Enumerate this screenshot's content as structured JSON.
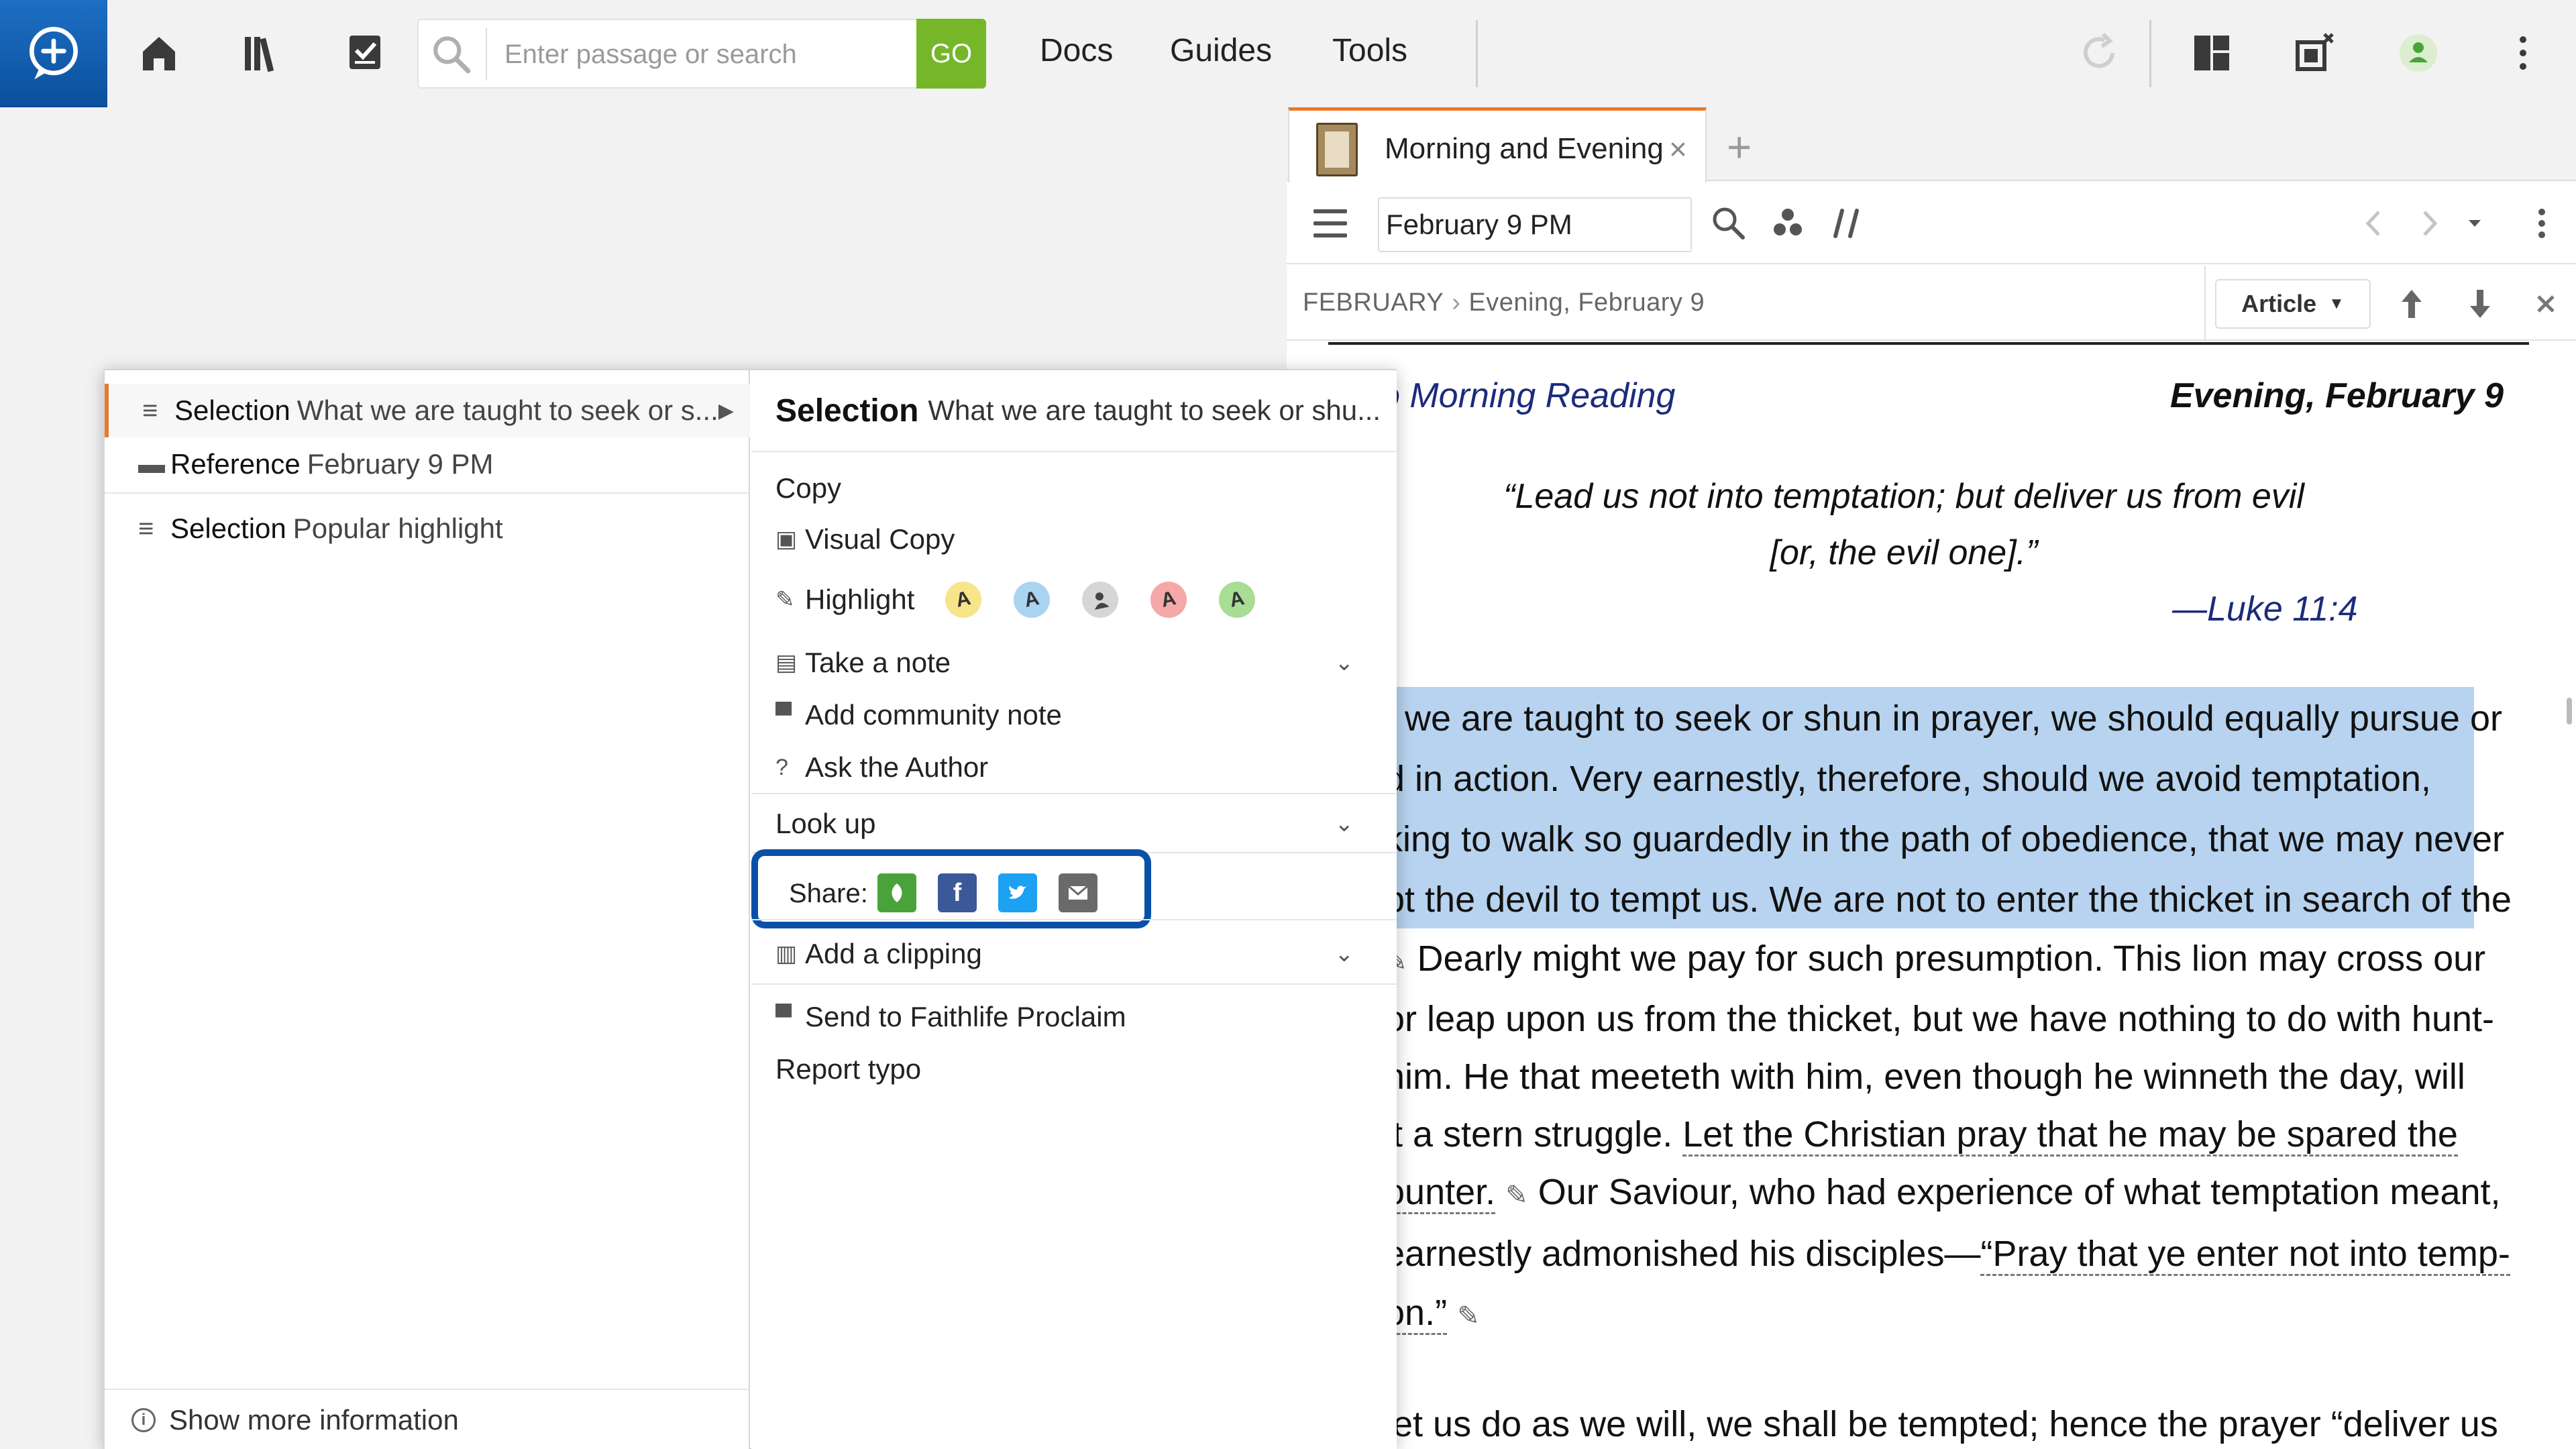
{
  "topbar": {
    "search_placeholder": "Enter passage or search",
    "go_label": "GO",
    "nav": [
      "Docs",
      "Guides",
      "Tools"
    ],
    "icons": [
      "logos-logo-icon",
      "home-icon",
      "library-icon",
      "checklist-icon",
      "search-icon",
      "sync-icon",
      "layout-icon",
      "close-panels-icon",
      "user-icon",
      "more-icon"
    ]
  },
  "panel": {
    "tab_title": "Morning and Evening",
    "tab_close": "×",
    "tab_add": "+",
    "reference_value": "February 9 PM",
    "breadcrumb": {
      "part1": "FEBRUARY",
      "separator": "›",
      "part2": "Evening, February 9"
    },
    "view_label": "Article"
  },
  "article": {
    "left_link": "o Morning Reading",
    "right_date": "Evening, February 9",
    "quote_line1": "“Lead us not into temptation; but deliver us from evil",
    "quote_line2": "[or, the evil one].”",
    "quote_ref": "—Luke 11:4",
    "lines": [
      "t we are taught to seek or shun in prayer, we should equally pursue or",
      "d in action. Very earnestly, therefore, should we avoid temptation,",
      "king to walk so guardedly in the path of obedience, that we may never",
      "pt the devil to tempt us. We are not to enter the thicket in search of the",
      "Dearly might we pay for such presumption. This lion may cross our",
      "or leap upon us from the thicket, but we have nothing to do with hunt-",
      "him. He that meeteth with him, even though he winneth the day, will",
      "it a stern struggle.",
      "Let the Christian pray that he may be spared the",
      "ounter.",
      "Our Saviour, who had experience of what temptation meant,",
      "earnestly admonished his disciples—",
      "“Pray that ye enter not into temp-",
      "on.”",
      "let us do as we will, we shall be tempted; hence the prayer “deliver us"
    ]
  },
  "context_menu": {
    "left": {
      "items": [
        {
          "key": "Selection",
          "value": "What we are taught to seek or s..."
        },
        {
          "key": "Reference",
          "value": "February 9 PM"
        },
        {
          "key": "Selection",
          "value": "Popular highlight"
        }
      ],
      "footer": "Show more information"
    },
    "right": {
      "header_key": "Selection",
      "header_value": "What we are taught to seek or shu...",
      "copy": "Copy",
      "visual_copy": "Visual Copy",
      "highlight": "Highlight",
      "highlight_swatches": [
        {
          "label": "A",
          "color": "#f7e58a"
        },
        {
          "label": "A",
          "color": "#a9d4f2"
        },
        {
          "label": "",
          "color": "#d6d6d6"
        },
        {
          "label": "A",
          "color": "#f4a8a8"
        },
        {
          "label": "A",
          "color": "#a9dc95"
        }
      ],
      "take_note": "Take a note",
      "community_note": "Add community note",
      "ask_author": "Ask the Author",
      "look_up": "Look up",
      "share_label": "Share:",
      "add_clipping": "Add a clipping",
      "send_proclaim": "Send to Faithlife Proclaim",
      "report_typo": "Report typo"
    }
  },
  "colors": {
    "accent_orange": "#e8792b",
    "go_green": "#76b72a",
    "share_highlight": "#0b50a8",
    "selection_blue": "#b7d3ef"
  }
}
